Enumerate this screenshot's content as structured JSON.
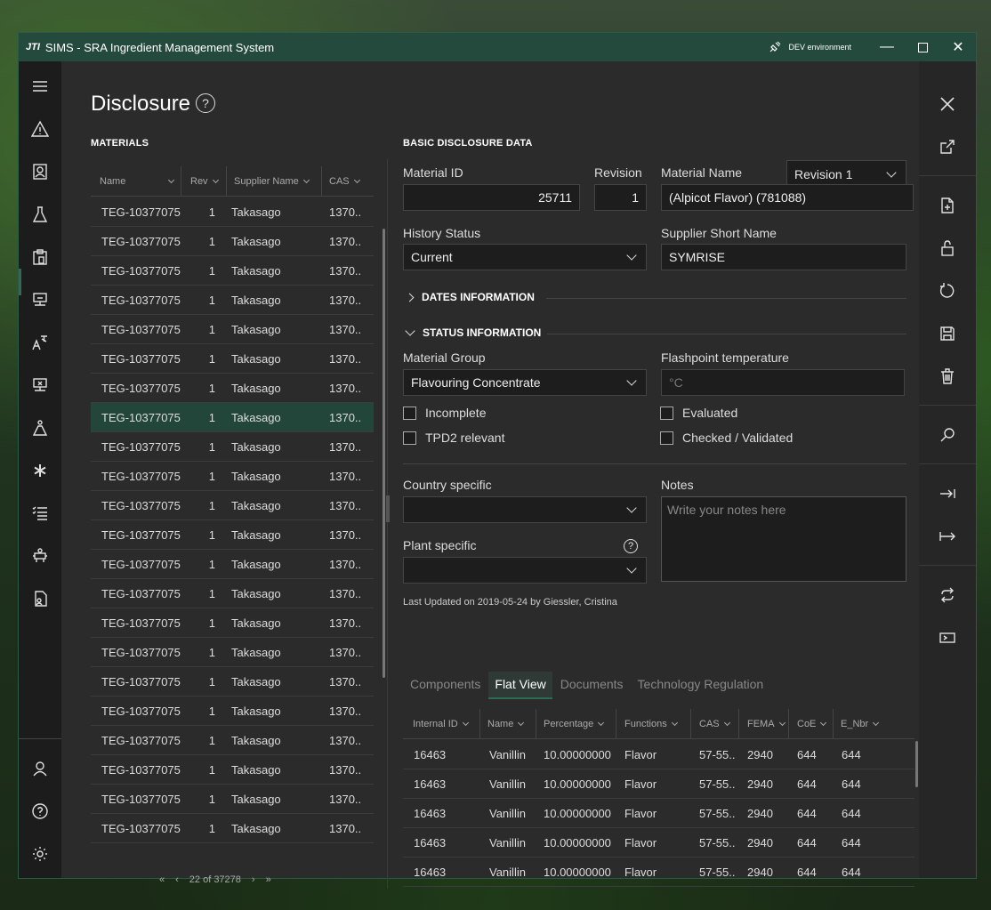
{
  "window": {
    "logo": "JTI",
    "title": "SIMS - SRA Ingredient Management System",
    "environment": "DEV environment"
  },
  "page": {
    "title": "Disclosure",
    "help": "?"
  },
  "materials": {
    "section_title": "MATERIALS",
    "columns": [
      "Name",
      "Rev",
      "Supplier Name",
      "CAS"
    ],
    "rows": [
      {
        "name": "TEG-10377075",
        "rev": "1",
        "supplier": "Takasago",
        "cas": "1370.."
      },
      {
        "name": "TEG-10377075",
        "rev": "1",
        "supplier": "Takasago",
        "cas": "1370.."
      },
      {
        "name": "TEG-10377075",
        "rev": "1",
        "supplier": "Takasago",
        "cas": "1370.."
      },
      {
        "name": "TEG-10377075",
        "rev": "1",
        "supplier": "Takasago",
        "cas": "1370.."
      },
      {
        "name": "TEG-10377075",
        "rev": "1",
        "supplier": "Takasago",
        "cas": "1370.."
      },
      {
        "name": "TEG-10377075",
        "rev": "1",
        "supplier": "Takasago",
        "cas": "1370.."
      },
      {
        "name": "TEG-10377075",
        "rev": "1",
        "supplier": "Takasago",
        "cas": "1370.."
      },
      {
        "name": "TEG-10377075",
        "rev": "1",
        "supplier": "Takasago",
        "cas": "1370.."
      },
      {
        "name": "TEG-10377075",
        "rev": "1",
        "supplier": "Takasago",
        "cas": "1370.."
      },
      {
        "name": "TEG-10377075",
        "rev": "1",
        "supplier": "Takasago",
        "cas": "1370.."
      },
      {
        "name": "TEG-10377075",
        "rev": "1",
        "supplier": "Takasago",
        "cas": "1370.."
      },
      {
        "name": "TEG-10377075",
        "rev": "1",
        "supplier": "Takasago",
        "cas": "1370.."
      },
      {
        "name": "TEG-10377075",
        "rev": "1",
        "supplier": "Takasago",
        "cas": "1370.."
      },
      {
        "name": "TEG-10377075",
        "rev": "1",
        "supplier": "Takasago",
        "cas": "1370.."
      },
      {
        "name": "TEG-10377075",
        "rev": "1",
        "supplier": "Takasago",
        "cas": "1370.."
      },
      {
        "name": "TEG-10377075",
        "rev": "1",
        "supplier": "Takasago",
        "cas": "1370.."
      },
      {
        "name": "TEG-10377075",
        "rev": "1",
        "supplier": "Takasago",
        "cas": "1370.."
      },
      {
        "name": "TEG-10377075",
        "rev": "1",
        "supplier": "Takasago",
        "cas": "1370.."
      },
      {
        "name": "TEG-10377075",
        "rev": "1",
        "supplier": "Takasago",
        "cas": "1370.."
      },
      {
        "name": "TEG-10377075",
        "rev": "1",
        "supplier": "Takasago",
        "cas": "1370.."
      },
      {
        "name": "TEG-10377075",
        "rev": "1",
        "supplier": "Takasago",
        "cas": "1370.."
      },
      {
        "name": "TEG-10377075",
        "rev": "1",
        "supplier": "Takasago",
        "cas": "1370.."
      }
    ],
    "selected_index": 7,
    "pager": "22 of 37278"
  },
  "basic": {
    "section_title": "BASIC DISCLOSURE DATA",
    "revision_select": "Revision 1",
    "material_id_label": "Material ID",
    "material_id": "25711",
    "revision_label": "Revision",
    "revision": "1",
    "material_name_label": "Material Name",
    "material_name": "(Alpicot Flavor) (781088)",
    "history_status_label": "History Status",
    "history_status": "Current",
    "supplier_short_label": "Supplier Short Name",
    "supplier_short": "SYMRISE",
    "dates_section": "DATES INFORMATION",
    "status_section": "STATUS INFORMATION",
    "material_group_label": "Material Group",
    "material_group": "Flavouring Concentrate",
    "flashpoint_label": "Flashpoint temperature",
    "flashpoint_placeholder": "°C",
    "incomplete": "Incomplete",
    "tpd2": "TPD2 relevant",
    "evaluated": "Evaluated",
    "checked": "Checked / Validated",
    "country_label": "Country specific",
    "plant_label": "Plant specific",
    "notes_label": "Notes",
    "notes_placeholder": "Write your notes here",
    "last_updated": "Last Updated on 2019-05-24 by Giessler, Cristina"
  },
  "tabs": [
    "Components",
    "Flat View",
    "Documents",
    "Technology Regulation"
  ],
  "active_tab": 1,
  "flat_view": {
    "columns": [
      "Internal ID",
      "Name",
      "Percentage",
      "Functions",
      "CAS",
      "FEMA",
      "CoE",
      "E_Nbr"
    ],
    "rows": [
      {
        "internal_id": "16463",
        "name": "Vanillin",
        "percentage": "10.00000000",
        "functions": "Flavor",
        "cas": "57-55..",
        "fema": "2940",
        "coe": "644",
        "enbr": "644"
      },
      {
        "internal_id": "16463",
        "name": "Vanillin",
        "percentage": "10.00000000",
        "functions": "Flavor",
        "cas": "57-55..",
        "fema": "2940",
        "coe": "644",
        "enbr": "644"
      },
      {
        "internal_id": "16463",
        "name": "Vanillin",
        "percentage": "10.00000000",
        "functions": "Flavor",
        "cas": "57-55..",
        "fema": "2940",
        "coe": "644",
        "enbr": "644"
      },
      {
        "internal_id": "16463",
        "name": "Vanillin",
        "percentage": "10.00000000",
        "functions": "Flavor",
        "cas": "57-55..",
        "fema": "2940",
        "coe": "644",
        "enbr": "644"
      },
      {
        "internal_id": "16463",
        "name": "Vanillin",
        "percentage": "10.00000000",
        "functions": "Flavor",
        "cas": "57-55..",
        "fema": "2940",
        "coe": "644",
        "enbr": "644"
      }
    ]
  },
  "nav_icons": [
    "hamburger-icon",
    "warning-icon",
    "contact-card-icon",
    "flask-icon",
    "clipboard-icon",
    "workstation-icon",
    "translate-icon",
    "workstation-x-icon",
    "beaker-person-icon",
    "asterisk-icon",
    "checklist-icon",
    "robot-icon",
    "document-person-icon",
    "user-icon",
    "help-icon",
    "settings-icon"
  ],
  "action_icons": [
    "close-icon",
    "export-icon",
    "new-document-icon",
    "lock-open-icon",
    "refresh-icon",
    "save-icon",
    "delete-icon",
    "search-icon",
    "move-right-icon",
    "extend-right-icon",
    "sync-icon",
    "console-icon"
  ],
  "colors": {
    "accent": "#2d6b55",
    "titlebar": "#234a3c",
    "selected_row": "#23463a"
  }
}
